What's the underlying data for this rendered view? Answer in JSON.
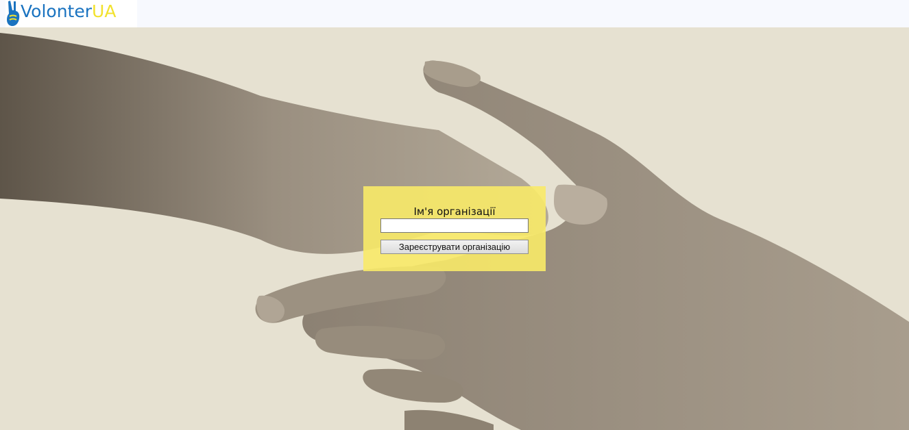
{
  "brand": {
    "name_part1": "Volonter",
    "name_part2": "UA",
    "color_blue": "#1a73c0",
    "color_yellow": "#f2e22e",
    "icon": "victory-hand-icon"
  },
  "hero": {
    "image": "handshake-photo",
    "background_color": "#e6e1d1"
  },
  "form": {
    "label": "Ім'я організації",
    "input_value": "",
    "input_placeholder": "",
    "submit_label": "Зареєструвати організацію",
    "panel_color": "#f8ea68"
  }
}
